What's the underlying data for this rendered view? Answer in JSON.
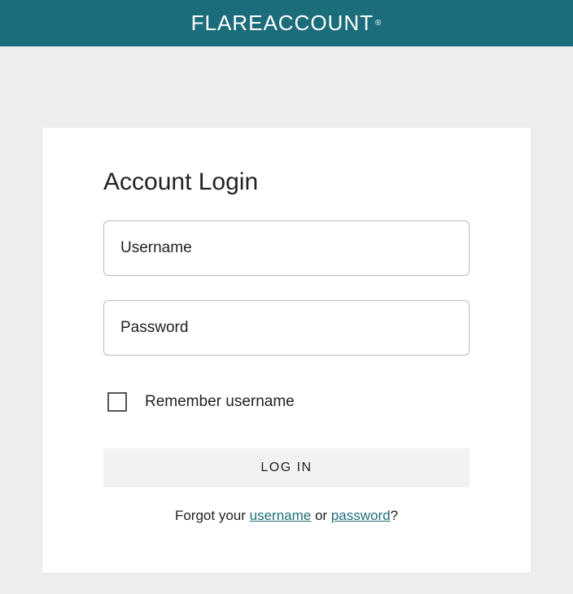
{
  "header": {
    "logo_flare": "FLARE",
    "logo_account": "ACCOUNT",
    "logo_reg": "®"
  },
  "login": {
    "title": "Account Login",
    "username_placeholder": "Username",
    "password_placeholder": "Password",
    "remember_label": "Remember username",
    "login_button": "LOG IN",
    "forgot_prefix": "Forgot your ",
    "forgot_username": "username",
    "forgot_or": " or ",
    "forgot_password": "password",
    "forgot_suffix": "?"
  }
}
